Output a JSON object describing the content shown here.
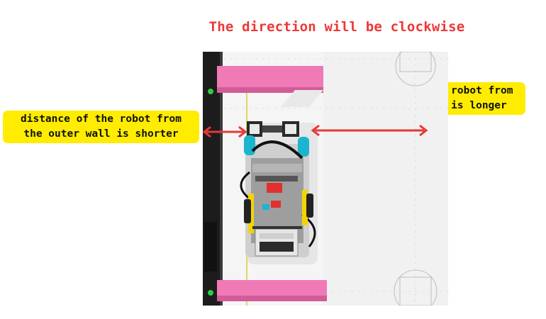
{
  "title": "The direction will be clockwise",
  "labels": {
    "outer": {
      "line1": "distance of the robot from",
      "line2": "the outer wall is shorter"
    },
    "inner": {
      "line1": "distance of the robot from",
      "line2": "the inner wall is longer"
    }
  },
  "colors": {
    "title": "#ee3636",
    "label_bg": "#ffec00",
    "arrow": "#e53935",
    "wall_pink": "#f06eb0",
    "outer_wall": "#1b1b1b",
    "mat": "#f4f4f4"
  }
}
